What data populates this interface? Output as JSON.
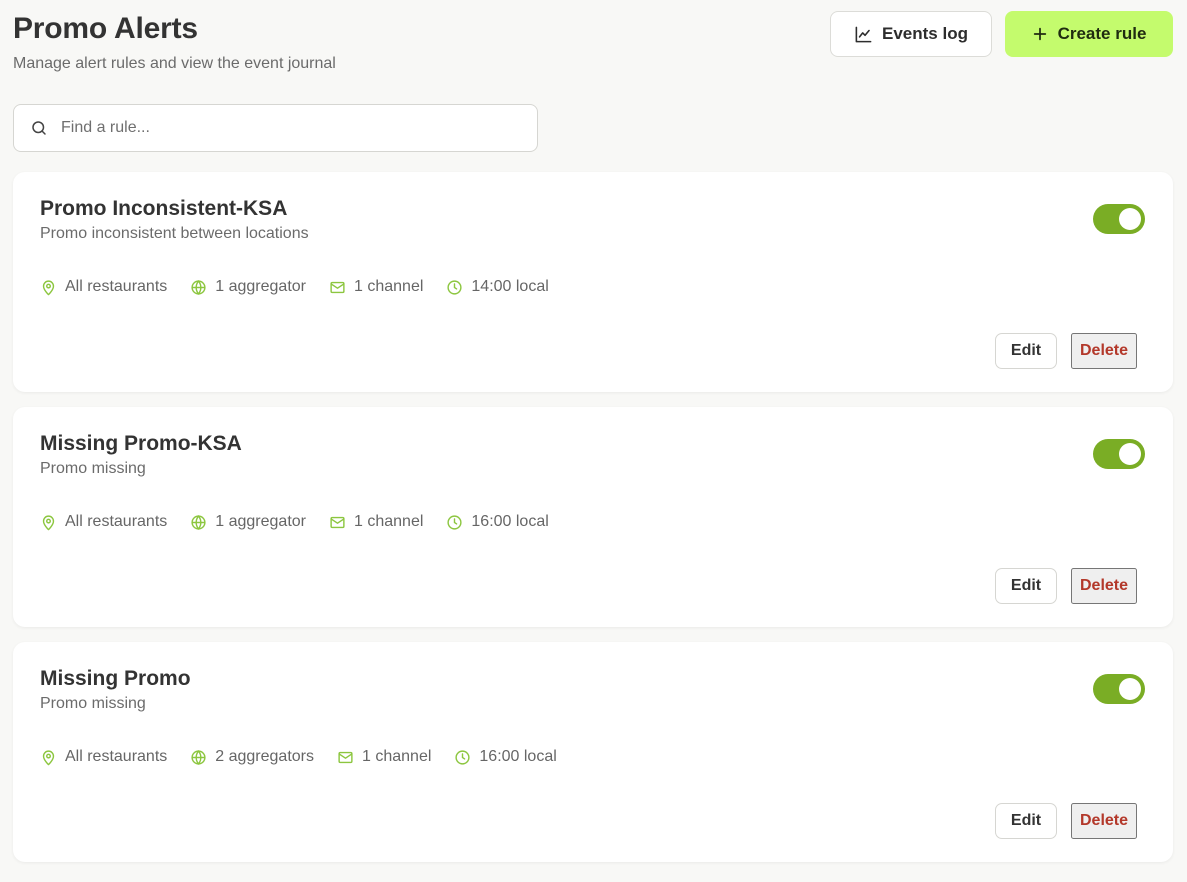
{
  "header": {
    "title": "Promo Alerts",
    "subtitle": "Manage alert rules and view the event journal",
    "events_log_label": "Events log",
    "create_rule_label": "Create rule"
  },
  "search": {
    "placeholder": "Find a rule...",
    "value": ""
  },
  "colors": {
    "accent": "#c4fb6d",
    "toggle_on": "#7aad25",
    "icon_green": "#8cc63f",
    "danger": "#b3382a"
  },
  "rules": [
    {
      "name": "Promo Inconsistent-KSA",
      "description": "Promo inconsistent between locations",
      "enabled": true,
      "restaurants": "All restaurants",
      "aggregators": "1 aggregator",
      "channels": "1 channel",
      "time": "14:00 local",
      "edit_label": "Edit",
      "delete_label": "Delete"
    },
    {
      "name": "Missing Promo-KSA",
      "description": "Promo missing",
      "enabled": true,
      "restaurants": "All restaurants",
      "aggregators": "1 aggregator",
      "channels": "1 channel",
      "time": "16:00 local",
      "edit_label": "Edit",
      "delete_label": "Delete"
    },
    {
      "name": "Missing Promo",
      "description": "Promo missing",
      "enabled": true,
      "restaurants": "All restaurants",
      "aggregators": "2 aggregators",
      "channels": "1 channel",
      "time": "16:00 local",
      "edit_label": "Edit",
      "delete_label": "Delete"
    }
  ]
}
